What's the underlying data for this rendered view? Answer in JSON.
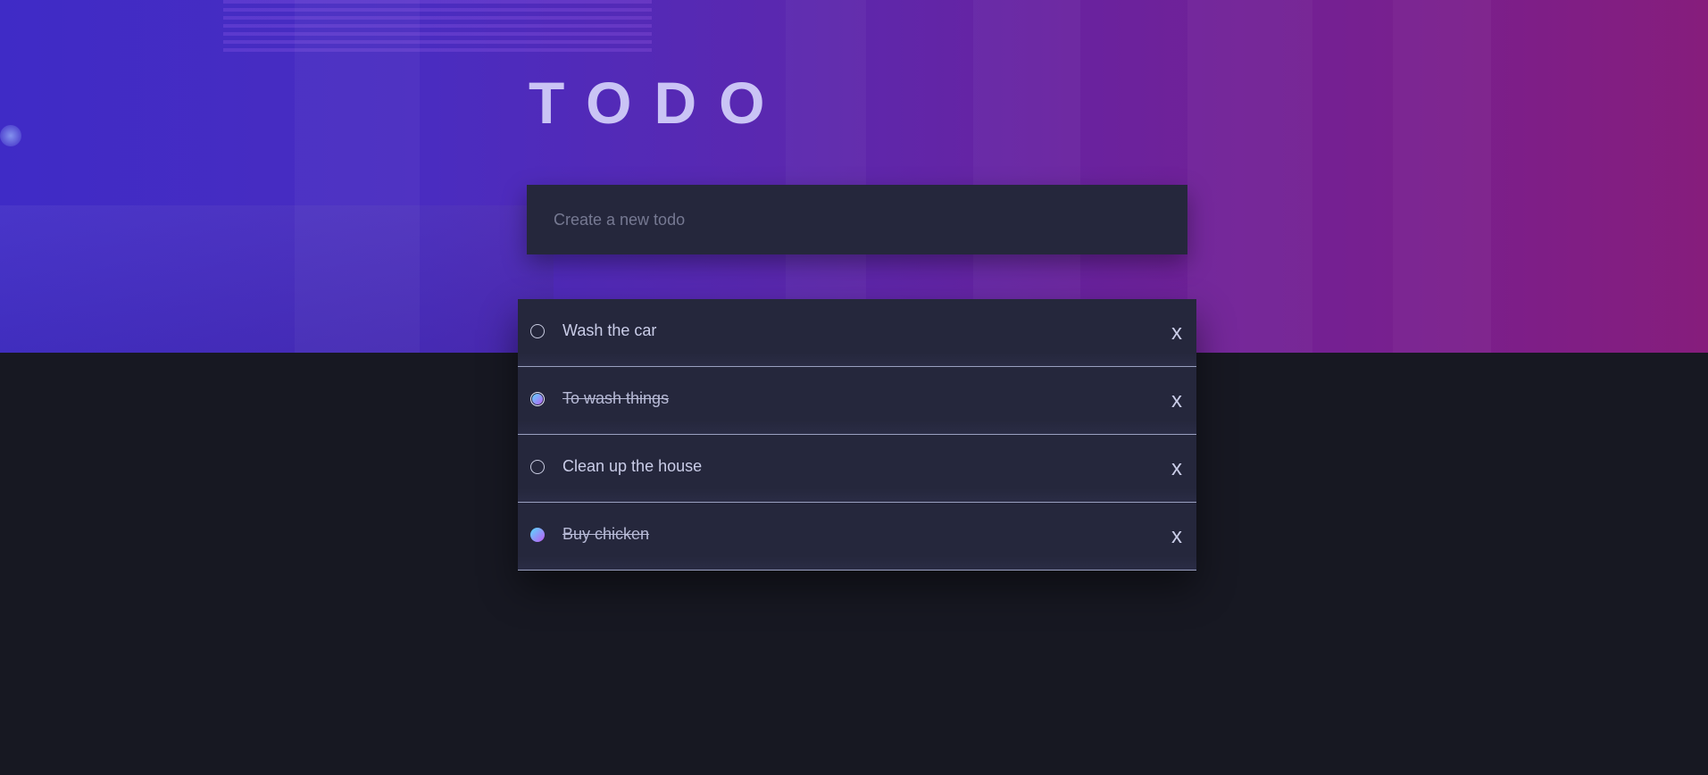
{
  "header": {
    "title": "TODO"
  },
  "new_todo": {
    "placeholder": "Create a new todo",
    "value": ""
  },
  "todos": [
    {
      "text": "Wash the car",
      "completed": false,
      "delete_label": "x"
    },
    {
      "text": "To wash things",
      "completed": true,
      "delete_label": "x"
    },
    {
      "text": "Clean up the house",
      "completed": false,
      "delete_label": "x"
    },
    {
      "text": "Buy chicken",
      "completed": true,
      "delete_label": "x"
    }
  ],
  "colors": {
    "background": "#171822",
    "card": "#25273c",
    "text": "#cacde8",
    "check_gradient_start": "#57ddff",
    "check_gradient_end": "#c058f3",
    "hero_gradient_start": "#3f2bc6",
    "hero_gradient_end": "#861d7c"
  },
  "icons": {
    "delete": "close-icon",
    "checkbox": "circle-checkbox-icon"
  }
}
